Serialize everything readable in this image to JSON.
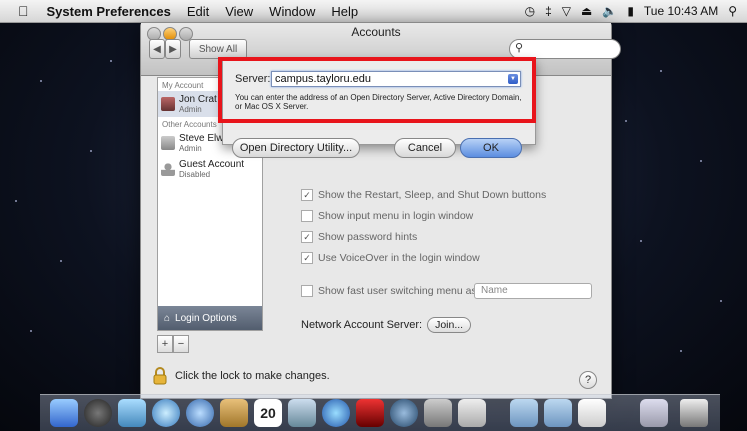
{
  "menubar": {
    "apple_icon": "apple-logo",
    "app_name": "System Preferences",
    "items": [
      "Edit",
      "View",
      "Window",
      "Help"
    ],
    "clock": "Tue 10:43 AM"
  },
  "window": {
    "title": "Accounts",
    "show_all": "Show All"
  },
  "sidebar": {
    "my_account_header": "My Account",
    "my_account": {
      "name": "Jon Crat",
      "role": "Admin"
    },
    "other_header": "Other Accounts",
    "others": [
      {
        "name": "Steve Elw",
        "role": "Admin"
      },
      {
        "name": "Guest Account",
        "role": "Disabled"
      }
    ],
    "login_options": "Login Options"
  },
  "content": {
    "options": [
      {
        "label": "Show the Restart, Sleep, and Shut Down buttons",
        "checked": true
      },
      {
        "label": "Show input menu in login window",
        "checked": false
      },
      {
        "label": "Show password hints",
        "checked": true
      },
      {
        "label": "Use VoiceOver in the login window",
        "checked": true
      }
    ],
    "fast_switch": {
      "label": "Show fast user switching menu as:",
      "value": "Name"
    },
    "network_server_label": "Network Account Server:",
    "join_label": "Join..."
  },
  "sheet": {
    "server_label": "Server:",
    "server_value": "campus.tayloru.edu",
    "hint": "You can enter the address of an Open Directory Server, Active Directory Domain, or Mac OS X Server.",
    "odu_button": "Open Directory Utility...",
    "cancel_button": "Cancel",
    "ok_button": "OK"
  },
  "lock_text": "Click the lock to make changes.",
  "help": "?",
  "dock_icons": [
    "finder-icon",
    "dashboard-icon",
    "mail-icon",
    "safari-icon",
    "ichat-icon",
    "address-book-icon",
    "ical-icon",
    "iphoto-icon",
    "itunes-icon",
    "dvd-icon",
    "time-machine-icon",
    "system-prefs-icon",
    "preview-icon",
    "applications-icon",
    "documents-icon",
    "downloads-icon",
    "trash-icon"
  ],
  "ical_date": "20"
}
